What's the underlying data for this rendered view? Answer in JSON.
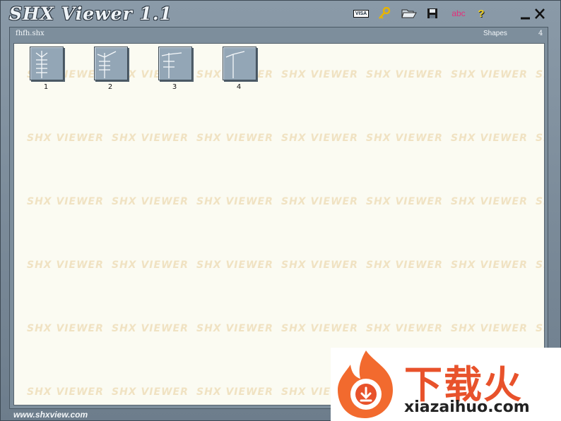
{
  "app": {
    "title": "SHX Viewer 1.1",
    "footer_url": "www.shxview.com"
  },
  "toolbar": {
    "items": [
      {
        "name": "visa-icon",
        "label": "VISA"
      },
      {
        "name": "key-icon",
        "label": ""
      },
      {
        "name": "open-folder-icon",
        "label": ""
      },
      {
        "name": "save-icon",
        "label": ""
      },
      {
        "name": "abc-icon",
        "label": "abc"
      },
      {
        "name": "help-icon",
        "label": "?"
      }
    ]
  },
  "subbar": {
    "filename": "fhfh.shx",
    "shapes_label": "Shapes",
    "shapes_count": "4"
  },
  "shapes": [
    {
      "label": "1"
    },
    {
      "label": "2"
    },
    {
      "label": "3"
    },
    {
      "label": "4"
    }
  ],
  "watermark": {
    "text": "SHX VIEWER"
  },
  "overlay_banner": {
    "brand_text": "下载火",
    "url": "xiazaihuo.com"
  },
  "colors": {
    "frame": "#7d8e9c",
    "canvas": "#fbfbf2",
    "watermark": "#f0e2c2",
    "brand": "#e8522b"
  }
}
